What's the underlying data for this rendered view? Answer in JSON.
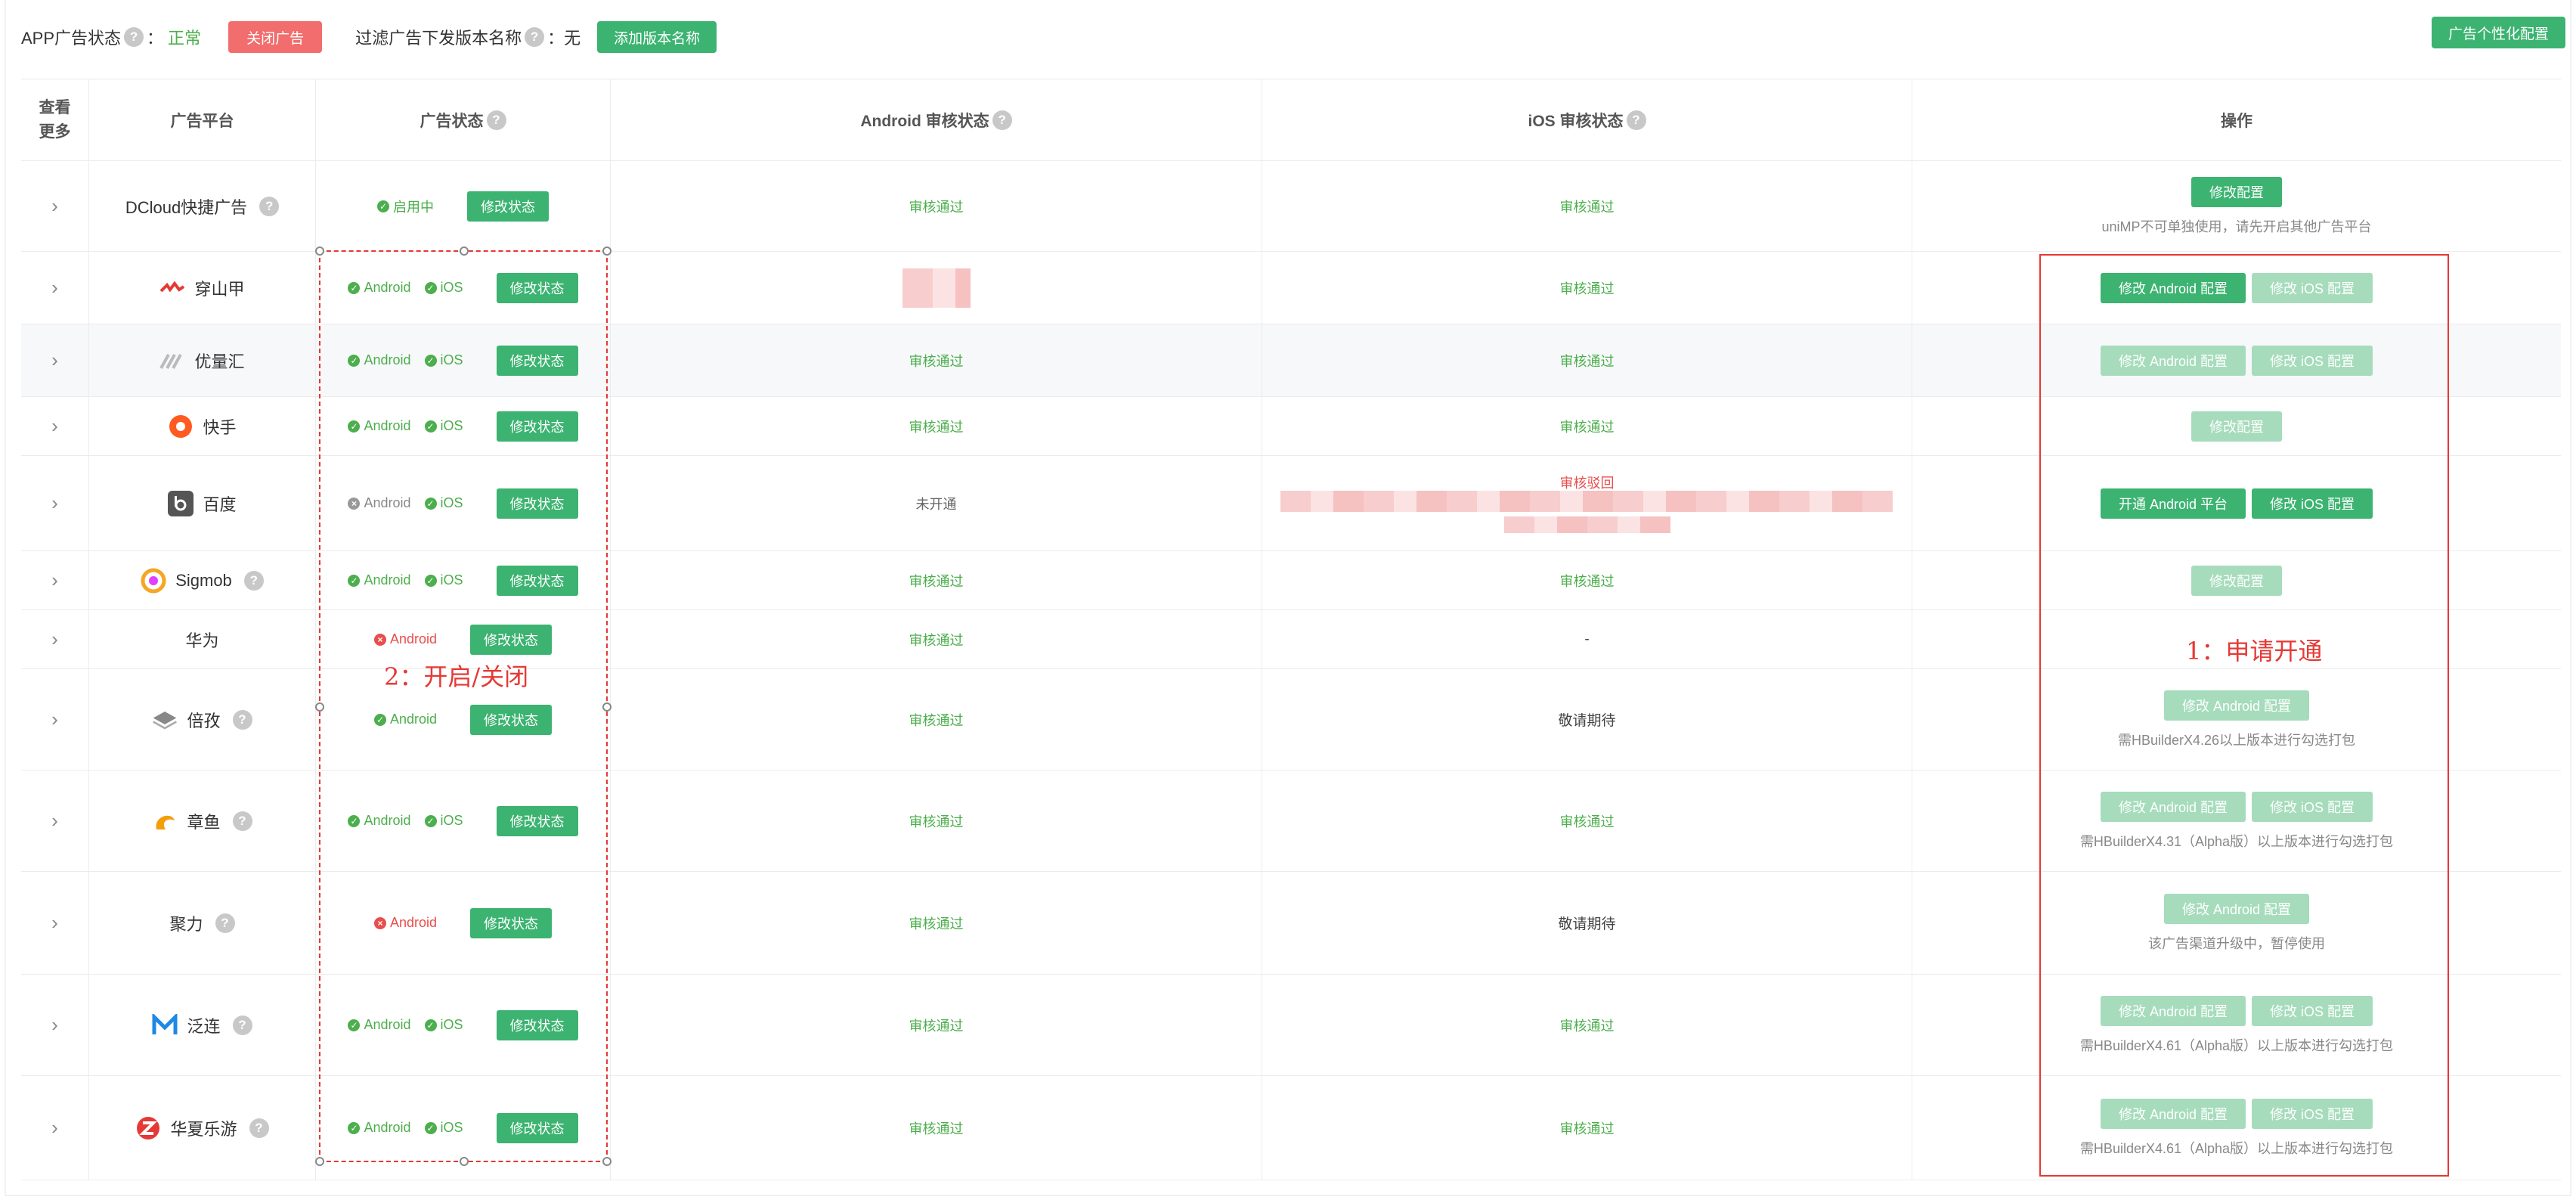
{
  "topbar": {
    "app_status_label": "APP广告状态",
    "colon": "：",
    "app_status_value": "正常",
    "close_ads_button": "关闭广告",
    "filter_label": "过滤广告下发版本名称",
    "filter_value": "无",
    "add_version_button": "添加版本名称",
    "personalize_button": "广告个性化配置"
  },
  "columns": {
    "more": "查看更多",
    "platform": "广告平台",
    "ad_status": "广告状态",
    "android_review": "Android 审核状态",
    "ios_review": "iOS 审核状态",
    "actions": "操作"
  },
  "rows": [
    {
      "name": "DCloud快捷广告",
      "status1": "启用中",
      "edit": "修改状态",
      "android": "审核通过",
      "ios": "审核通过",
      "op1": "修改配置",
      "note": "uniMP不可单独使用，请先开启其他广告平台"
    },
    {
      "name": "穿山甲",
      "status1": "Android",
      "status2": "iOS",
      "edit": "修改状态",
      "android": "",
      "ios": "审核通过",
      "op1": "修改 Android 配置",
      "op2": "修改 iOS 配置"
    },
    {
      "name": "优量汇",
      "status1": "Android",
      "status2": "iOS",
      "edit": "修改状态",
      "android": "审核通过",
      "ios": "审核通过",
      "op1": "修改 Android 配置",
      "op2": "修改 iOS 配置"
    },
    {
      "name": "快手",
      "status1": "Android",
      "status2": "iOS",
      "edit": "修改状态",
      "android": "审核通过",
      "ios": "审核通过",
      "op1": "修改配置"
    },
    {
      "name": "百度",
      "status1": "Android",
      "status2": "iOS",
      "edit": "修改状态",
      "android": "未开通",
      "ios": "审核驳回",
      "op1": "开通 Android 平台",
      "op2": "修改 iOS 配置"
    },
    {
      "name": "Sigmob",
      "status1": "Android",
      "status2": "iOS",
      "edit": "修改状态",
      "android": "审核通过",
      "ios": "审核通过",
      "op1": "修改配置"
    },
    {
      "name": "华为",
      "status1": "Android",
      "edit": "修改状态",
      "android": "审核通过",
      "ios": "-"
    },
    {
      "name": "倍孜",
      "status1": "Android",
      "edit": "修改状态",
      "android": "审核通过",
      "ios": "敬请期待",
      "op1": "修改 Android 配置",
      "note": "需HBuilderX4.26以上版本进行勾选打包"
    },
    {
      "name": "章鱼",
      "status1": "Android",
      "status2": "iOS",
      "edit": "修改状态",
      "android": "审核通过",
      "ios": "审核通过",
      "op1": "修改 Android 配置",
      "op2": "修改 iOS 配置",
      "note": "需HBuilderX4.31（Alpha版）以上版本进行勾选打包"
    },
    {
      "name": "聚力",
      "status1": "Android",
      "edit": "修改状态",
      "android": "审核通过",
      "ios": "敬请期待",
      "op1": "修改 Android 配置",
      "note": "该广告渠道升级中，暂停使用"
    },
    {
      "name": "泛连",
      "status1": "Android",
      "status2": "iOS",
      "edit": "修改状态",
      "android": "审核通过",
      "ios": "审核通过",
      "op1": "修改 Android 配置",
      "op2": "修改 iOS 配置",
      "note": "需HBuilderX4.61（Alpha版）以上版本进行勾选打包"
    },
    {
      "name": "华夏乐游",
      "status1": "Android",
      "status2": "iOS",
      "edit": "修改状态",
      "android": "审核通过",
      "ios": "审核通过",
      "op1": "修改 Android 配置",
      "op2": "修改 iOS 配置",
      "note": "需HBuilderX4.61（Alpha版）以上版本进行勾选打包"
    }
  ],
  "annotations": {
    "apply": "1：申请开通",
    "toggle": "2：开启/关闭"
  },
  "colors": {
    "green": "#3cb371",
    "green_disabled": "#a6dcbc",
    "red": "#f26d6d",
    "annotation": "#e53935"
  }
}
